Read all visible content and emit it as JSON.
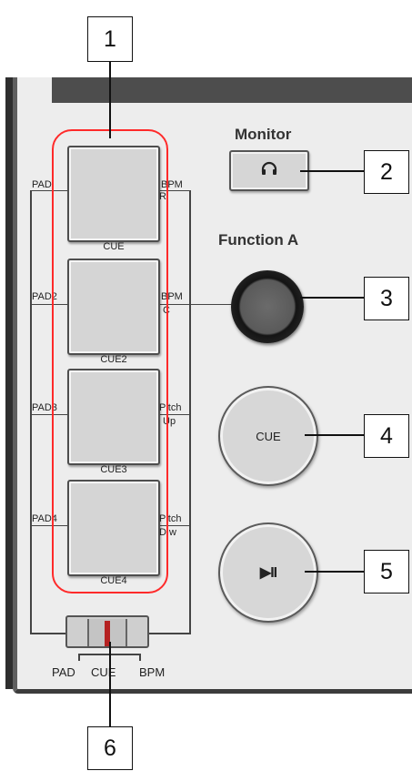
{
  "callouts": [
    "1",
    "2",
    "3",
    "4",
    "5",
    "6"
  ],
  "monitor": {
    "heading": "Monitor",
    "icon": "headphones-icon"
  },
  "function_a": {
    "heading": "Function A"
  },
  "cue_button": {
    "label": "CUE"
  },
  "play_pause_button": {
    "label": "▶II"
  },
  "pads": [
    {
      "left": "PAD",
      "right_top": "BPM",
      "right_bottom": "R",
      "bottom": "CUE"
    },
    {
      "left": "PAD2",
      "right_top": "BPM",
      "right_bottom": "C",
      "bottom": "CUE2"
    },
    {
      "left": "PAD3",
      "right_top": "Pitch",
      "right_bottom": "Up",
      "bottom": "CUE3"
    },
    {
      "left": "PAD4",
      "right_top": "Pitch",
      "right_bottom": "D w",
      "bottom": "CUE4"
    }
  ],
  "fader": {
    "labels": [
      "PAD",
      "CUE",
      "BPM"
    ]
  },
  "colors": {
    "highlight": "#ff2a2a",
    "fader_marker": "#b52222"
  }
}
